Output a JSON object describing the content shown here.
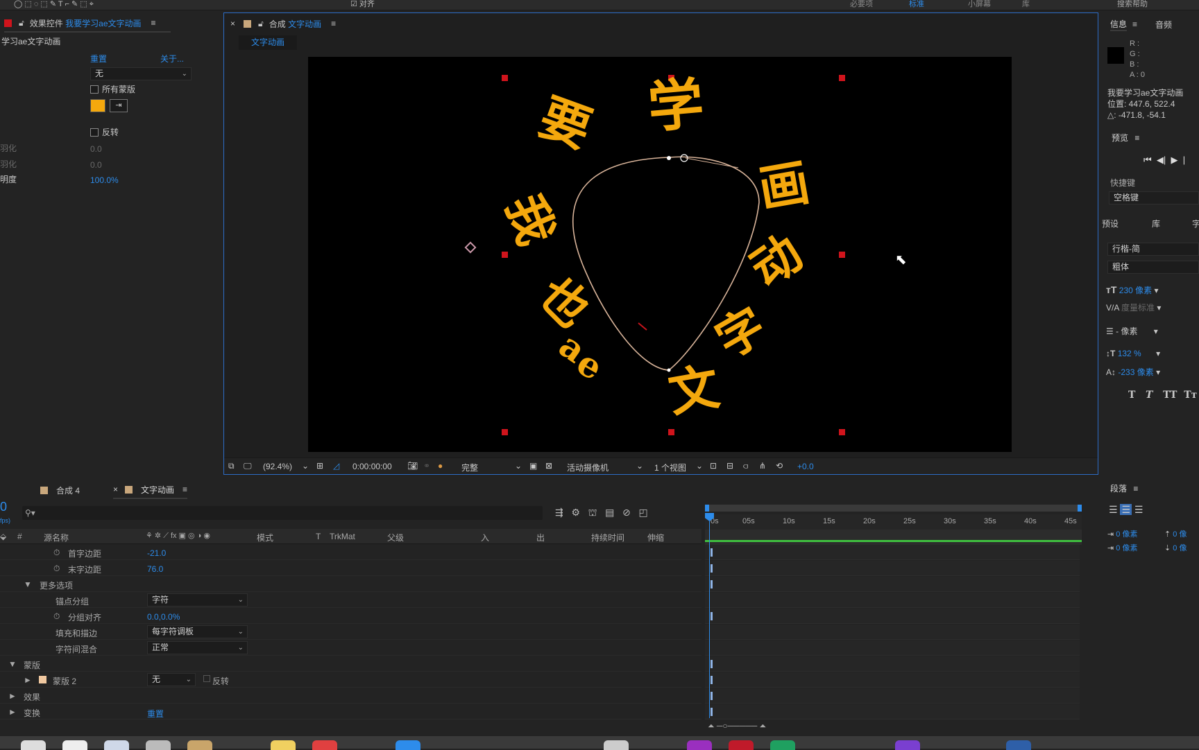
{
  "topbar": {
    "workspaces": [
      "必要项",
      "标准",
      "小屏幕",
      "库"
    ],
    "align_label": "对齐",
    "search_placeholder": "搜索帮助"
  },
  "effects_panel": {
    "tab_title": "效果控件",
    "tab_layer": "我要学习ae文字动画",
    "layer_title": "学习ae文字动画",
    "reset": "重置",
    "about": "关于...",
    "mask_select": "无",
    "all_masks": "所有蒙版",
    "invert": "反转",
    "feather1_label": "羽化",
    "feather1_val": "0.0",
    "feather2_label": "羽化",
    "feather2_val": "0.0",
    "opacity_label": "明度",
    "opacity_val": "100.0%",
    "color_swatch": "#f4a80d"
  },
  "comp_panel": {
    "tab_label": "合成",
    "tab_name": "文字动画",
    "subtab": "文字动画",
    "zoom": "(92.4%)",
    "timecode": "0:00:00:00",
    "quality": "完整",
    "camera": "活动摄像机",
    "views": "1 个视图",
    "exposure": "+0.0",
    "glyphs": [
      "画",
      "动",
      "字",
      "文",
      "e",
      "a",
      "也",
      "我",
      "要",
      "学"
    ]
  },
  "info_panel": {
    "tab_info": "信息",
    "tab_audio": "音频",
    "r": "R :",
    "g": "G :",
    "b": "B :",
    "a": "A : 0",
    "layer_name": "我要学习ae文字动画",
    "position": "位置: 447.6, 522.4",
    "delta": "△: -471.8, -54.1"
  },
  "preview_panel": {
    "title": "预览",
    "shortcut_label": "快捷键",
    "shortcut_value": "空格键"
  },
  "char_panel": {
    "tab_presets": "预设",
    "tab_lib": "库",
    "tab_char": "字",
    "font": "行楷-简",
    "style": "粗体",
    "size": "230 像素",
    "kerning": "度量标准",
    "leading": "- 像素",
    "vscale": "132 %",
    "baseline": "-233 像素",
    "fmt_buttons": [
      "T",
      "T",
      "TT",
      "Tт"
    ]
  },
  "para_panel": {
    "title": "段落",
    "indent1": "0 像素",
    "indent2": "0 像素",
    "space1": "0 像",
    "space2": "0 像"
  },
  "timeline": {
    "tabs": [
      "合成 4",
      "文字动画"
    ],
    "timecode_frag": "0",
    "fps_frag": "fps)",
    "columns": [
      "#",
      "源名称",
      "模式",
      "T",
      "TrkMat",
      "父级",
      "入",
      "出",
      "持续时间",
      "伸缩"
    ],
    "ruler_ticks": [
      "0s",
      "05s",
      "10s",
      "15s",
      "20s",
      "25s",
      "30s",
      "35s",
      "40s",
      "45s"
    ],
    "rows": [
      {
        "label": "首字边距",
        "value": "-21.0"
      },
      {
        "label": "末字边距",
        "value": "76.0"
      },
      {
        "label": "更多选项",
        "value": ""
      },
      {
        "label": "锚点分组",
        "value": "字符"
      },
      {
        "label": "分组对齐",
        "value": "0.0,0.0%"
      },
      {
        "label": "填充和描边",
        "value": "每字符调板"
      },
      {
        "label": "字符间混合",
        "value": "正常"
      },
      {
        "label": "蒙版",
        "value": ""
      },
      {
        "label": "蒙版 2",
        "value": "无",
        "extra": "反转"
      },
      {
        "label": "效果",
        "value": ""
      },
      {
        "label": "变换",
        "value": "重置"
      }
    ]
  }
}
